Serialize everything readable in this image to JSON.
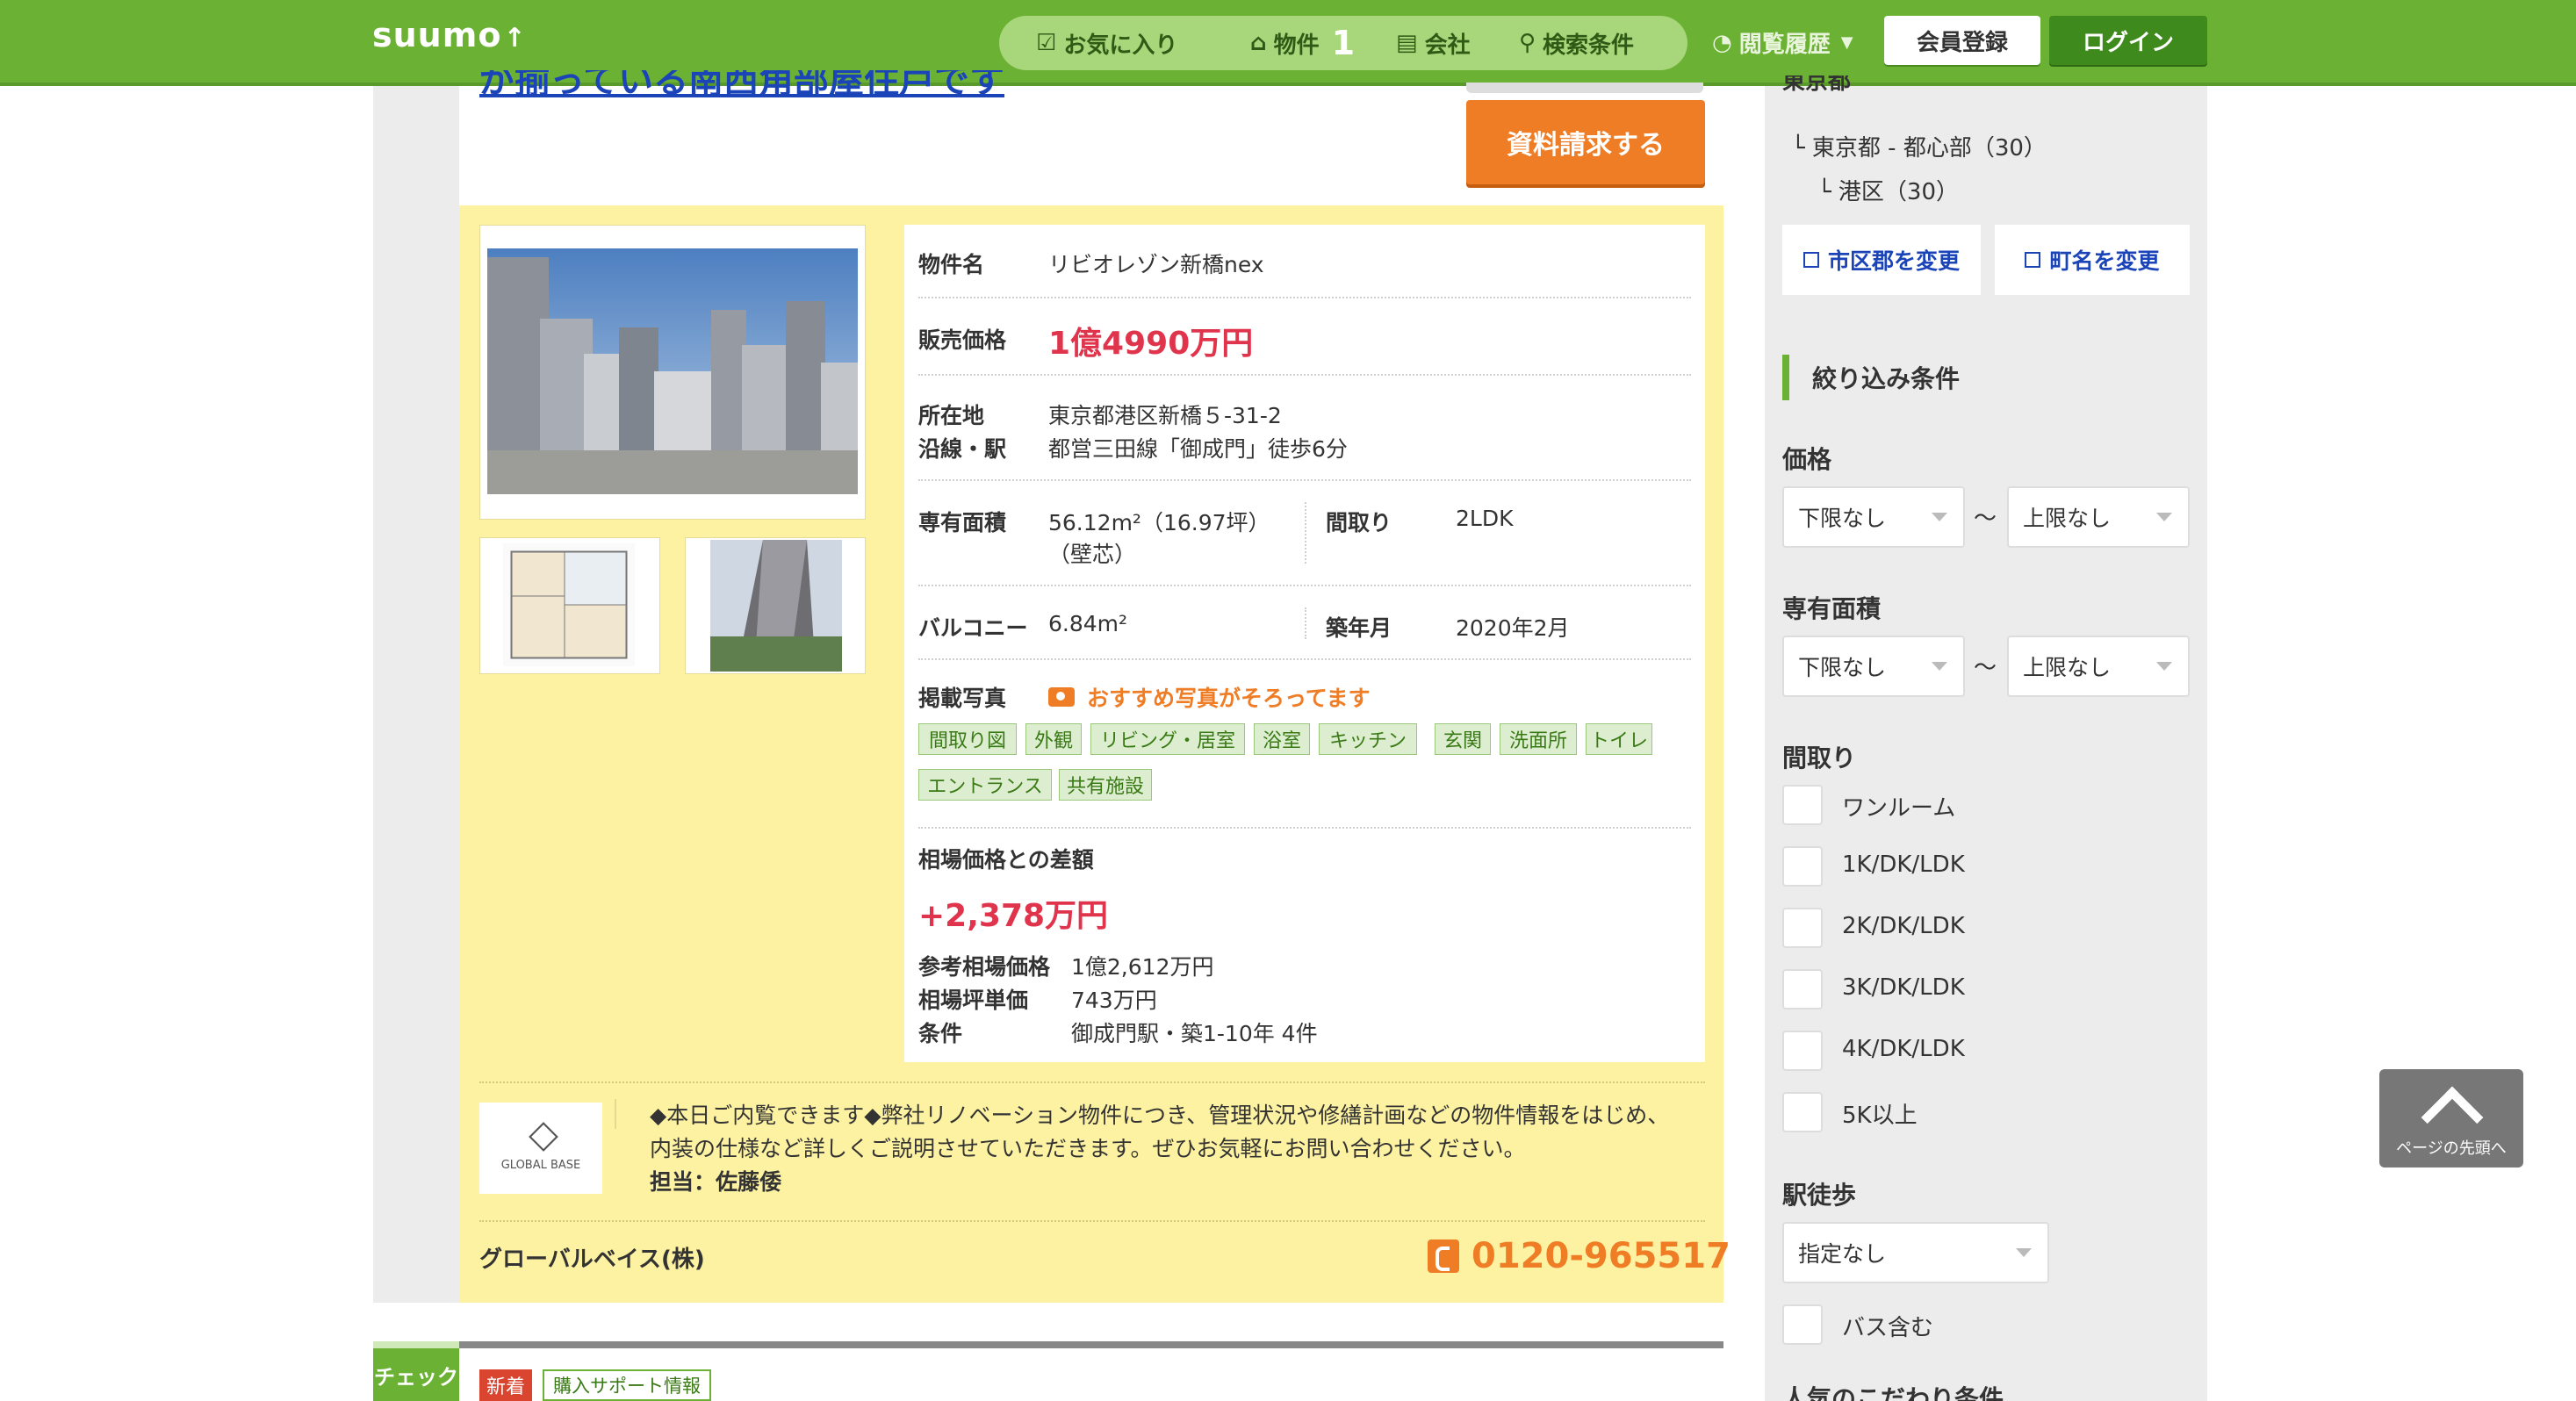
{
  "header": {
    "logo": "suumo",
    "nav": [
      {
        "label": "お気に入り",
        "icon": "check-box-icon"
      },
      {
        "label": "物件",
        "icon": "house-icon",
        "count": "1"
      },
      {
        "label": "会社",
        "icon": "building-icon"
      },
      {
        "label": "検索条件",
        "icon": "search-icon"
      }
    ],
    "history_label": "閲覧履歴",
    "register_label": "会員登録",
    "login_label": "ログイン"
  },
  "listing": {
    "title_link": "が揃っている南西角部屋住戸です",
    "request_button": "資料請求する",
    "fields": {
      "name_label": "物件名",
      "name": "リビオレゾン新橋nex",
      "price_label": "販売価格",
      "price": "1億4990万円",
      "address_label": "所在地",
      "address": "東京都港区新橋５-31-2",
      "station_label": "沿線・駅",
      "station": "都営三田線「御成門」徒歩6分",
      "area_label": "専有面積",
      "area": "56.12m²（16.97坪）",
      "area_note": "（壁芯）",
      "layout_label": "間取り",
      "layout": "2LDK",
      "balcony_label": "バルコニー",
      "balcony": "6.84m²",
      "built_label": "築年月",
      "built": "2020年2月",
      "photos_label": "掲載写真",
      "photos_note": "おすすめ写真がそろってます",
      "photo_tags": [
        "間取り図",
        "外観",
        "リビング・居室",
        "浴室",
        "キッチン",
        "玄関",
        "洗面所",
        "トイレ",
        "エントランス",
        "共有施設"
      ]
    },
    "market": {
      "title": "相場価格との差額",
      "diff": "+2,378万円",
      "ref_price_label": "参考相場価格",
      "ref_price": "1億2,612万円",
      "unit_price_label": "相場坪単価",
      "unit_price": "743万円",
      "condition_label": "条件",
      "condition": "御成門駅・築1-10年 4件"
    },
    "company": {
      "logo_text": "GLOBAL BASE",
      "message": "◆本日ご内覧できます◆弊社リノベーション物件につき、管理状況や修繕計画などの物件情報をはじめ、内装の仕様など詳しくご説明させていただきます。ぜひお気軽にお問い合わせください。",
      "staff": "担当：佐藤倭",
      "name": "グローバルベイス(株)",
      "phone": "0120-965517"
    },
    "next": {
      "check_tab": "チェック",
      "new_tag": "新着",
      "support_tag": "購入サポート情報"
    }
  },
  "sidebar": {
    "pref": "東京都",
    "area": "東京都 - 都心部（30）",
    "ward": "港区（30）",
    "change_city": "市区郡を変更",
    "change_town": "町名を変更",
    "filter_title": "絞り込み条件",
    "price_label": "価格",
    "price_min": "下限なし",
    "price_max": "上限なし",
    "area_label": "専有面積",
    "area_min": "下限なし",
    "area_max": "上限なし",
    "range_sep": "〜",
    "layout_label": "間取り",
    "layouts": [
      "ワンルーム",
      "1K/DK/LDK",
      "2K/DK/LDK",
      "3K/DK/LDK",
      "4K/DK/LDK",
      "5K以上"
    ],
    "walk_label": "駅徒歩",
    "walk_value": "指定なし",
    "bus_label": "バス含む",
    "popular_label": "人気のこだわり条件"
  },
  "back_to_top": "ページの先頭へ"
}
